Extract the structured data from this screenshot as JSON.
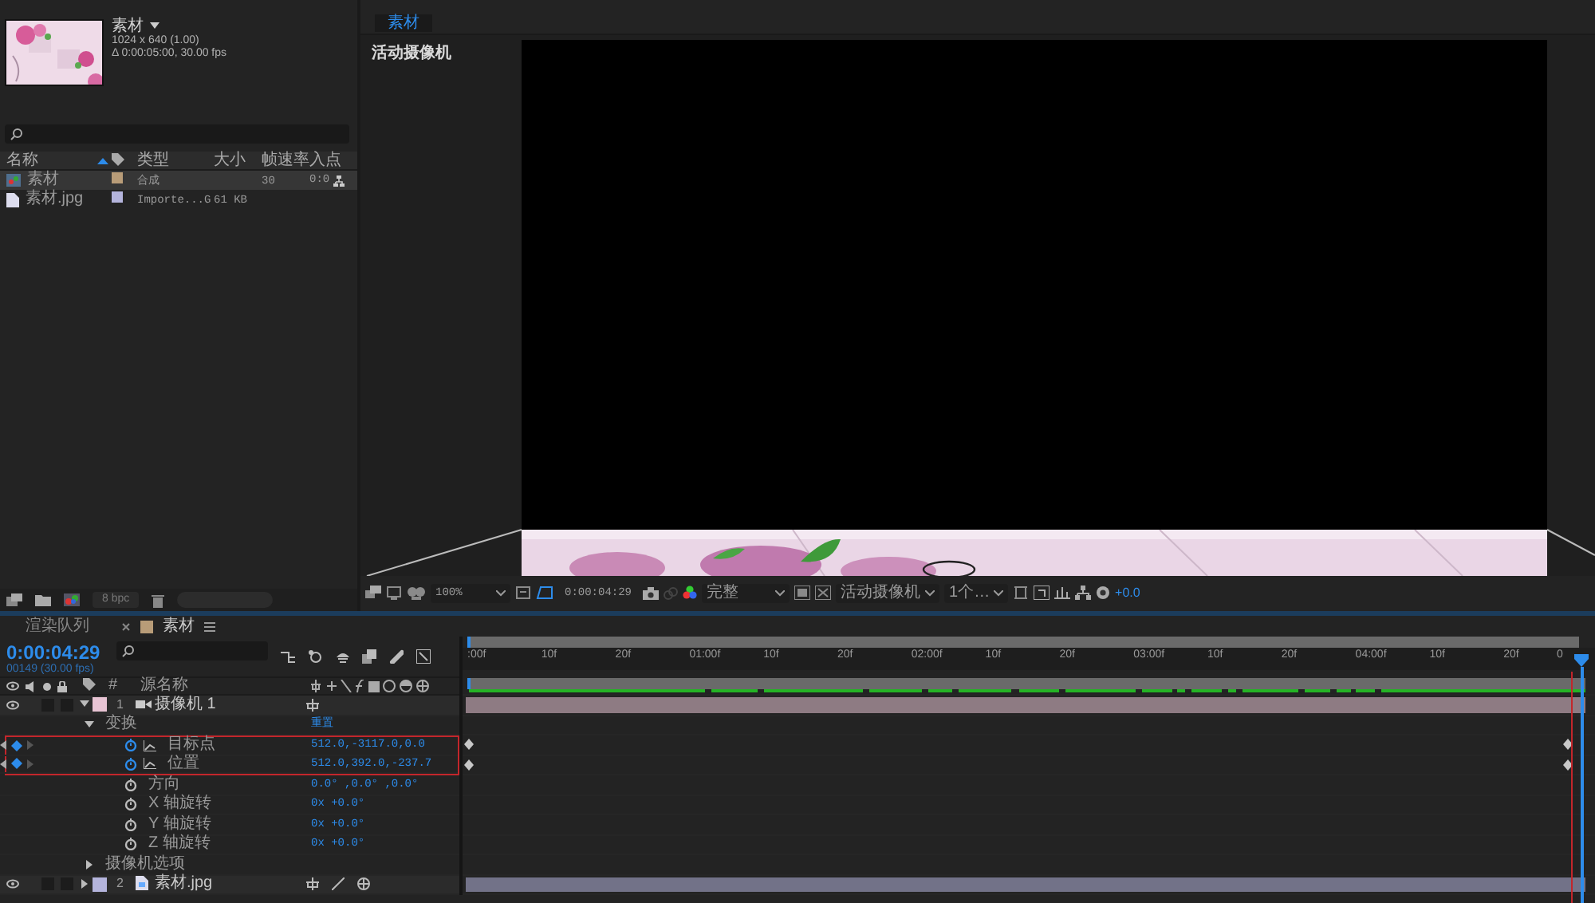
{
  "project": {
    "thumbnail": {
      "kind": "picture"
    },
    "name": "素材",
    "details": [
      "1024 x 640 (1.00)",
      "Δ 0:00:05:00, 30.00 fps"
    ],
    "columns": [
      "名称",
      "类型",
      "大小",
      "帧速率",
      "入点"
    ],
    "items": [
      {
        "kind": "composition",
        "name": "素材",
        "type": "合成",
        "fps": "30",
        "in": "0:0",
        "selected": true,
        "color": "#b89c78"
      },
      {
        "name": "素材.jpg",
        "type": "Importe...G",
        "size": "61 KB",
        "selected": false,
        "color": "#b4b4dc"
      }
    ],
    "bit_depth": "8 bpc"
  },
  "viewer": {
    "tab": "素材",
    "camera_label": "活动摄像机",
    "zoom": "100%",
    "timecode": "0:00:04:29",
    "resolution": "完整",
    "camera": "活动摄像机",
    "views": "1个…",
    "exposure": "+0.0"
  },
  "timeline": {
    "tabs": [
      {
        "label": "渲染队列",
        "selected": false
      },
      {
        "label": "素材",
        "selected": true,
        "color": "#b89c78"
      }
    ],
    "timecode": "0:00:04:29",
    "frame_info": "00149 (30.00 fps)",
    "number_column": "#",
    "name_column": "源名称",
    "ruler": [
      ":00f",
      "10f",
      "20f",
      "01:00f",
      "10f",
      "20f",
      "02:00f",
      "10f",
      "20f",
      "03:00f",
      "10f",
      "20f",
      "04:00f",
      "10f",
      "20f",
      "0"
    ],
    "layers": [
      {
        "kind": "camera",
        "number": "1",
        "name": "摄像机 1",
        "color": "#e8c4d4",
        "expanded": true,
        "children": [
          {
            "kind": "group",
            "name": "变换",
            "value": "重置",
            "expanded": true,
            "children": [
              {
                "kind": "property",
                "name": "目标点",
                "value": "512.0,-3117.0,0.0",
                "keyframed": true,
                "highlighted": true
              },
              {
                "kind": "property",
                "name": "位置",
                "value": "512.0,392.0,-237.7",
                "keyframed": true,
                "highlighted": true
              },
              {
                "kind": "property",
                "name": "方向",
                "value": "0.0° ,0.0° ,0.0°",
                "keyframed": false,
                "highlighted": false
              },
              {
                "kind": "property",
                "name": "X 轴旋转",
                "value": "0x +0.0°",
                "keyframed": false,
                "highlighted": false
              },
              {
                "kind": "property",
                "name": "Y 轴旋转",
                "value": "0x +0.0°",
                "keyframed": false,
                "highlighted": false
              },
              {
                "kind": "property",
                "name": "Z 轴旋转",
                "value": "0x +0.0°",
                "keyframed": false,
                "highlighted": false
              }
            ]
          },
          {
            "kind": "group",
            "name": "摄像机选项",
            "expanded": false
          }
        ]
      },
      {
        "number": "2",
        "name": "素材.jpg",
        "color": "#b4b4dc",
        "expanded": false
      }
    ]
  }
}
